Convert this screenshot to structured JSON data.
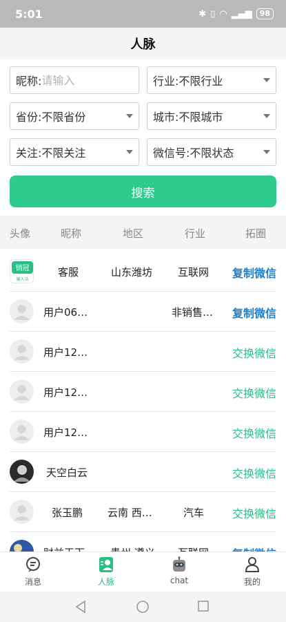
{
  "status": {
    "time": "5:01",
    "battery": "98"
  },
  "title": "人脉",
  "filters": {
    "nickname_label": "昵称:",
    "nickname_placeholder": "请输入",
    "industry": "行业:不限行业",
    "province": "省份:不限省份",
    "city": "城市:不限城市",
    "follow": "关注:不限关注",
    "wechat": "微信号:不限状态",
    "search_button": "搜索"
  },
  "columns": [
    "头像",
    "昵称",
    "地区",
    "行业",
    "拓圈"
  ],
  "rows": [
    {
      "avatar": "logo",
      "nickname": "客服",
      "region": "山东潍坊",
      "industry": "互联网",
      "action": "复制微信",
      "action_style": "blue"
    },
    {
      "avatar": "default",
      "nickname": "用户06…",
      "region": "",
      "industry": "非销售…",
      "action": "复制微信",
      "action_style": "blue"
    },
    {
      "avatar": "default",
      "nickname": "用户12…",
      "region": "",
      "industry": "",
      "action": "交换微信",
      "action_style": "green"
    },
    {
      "avatar": "default",
      "nickname": "用户12…",
      "region": "",
      "industry": "",
      "action": "交换微信",
      "action_style": "green"
    },
    {
      "avatar": "default",
      "nickname": "用户12…",
      "region": "",
      "industry": "",
      "action": "交换微信",
      "action_style": "green"
    },
    {
      "avatar": "photo",
      "nickname": "天空白云",
      "region": "",
      "industry": "",
      "action": "交换微信",
      "action_style": "green"
    },
    {
      "avatar": "default",
      "nickname": "张玉鹏",
      "region": "云南 西…",
      "industry": "汽车",
      "action": "交换微信",
      "action_style": "green"
    },
    {
      "avatar": "photo2",
      "nickname": "财益天下",
      "region": "贵州 遵义",
      "industry": "互联网",
      "action": "复制微信",
      "action_style": "blue"
    }
  ],
  "logo_text": {
    "main": "销冠",
    "sub": "输入法"
  },
  "nav": [
    {
      "label": "消息",
      "icon": "message-icon"
    },
    {
      "label": "人脉",
      "icon": "contacts-icon",
      "active": true
    },
    {
      "label": "chat",
      "icon": "robot-icon"
    },
    {
      "label": "我的",
      "icon": "profile-icon"
    }
  ],
  "colors": {
    "accent": "#2ecb8e",
    "link_blue": "#1d7ecc"
  }
}
